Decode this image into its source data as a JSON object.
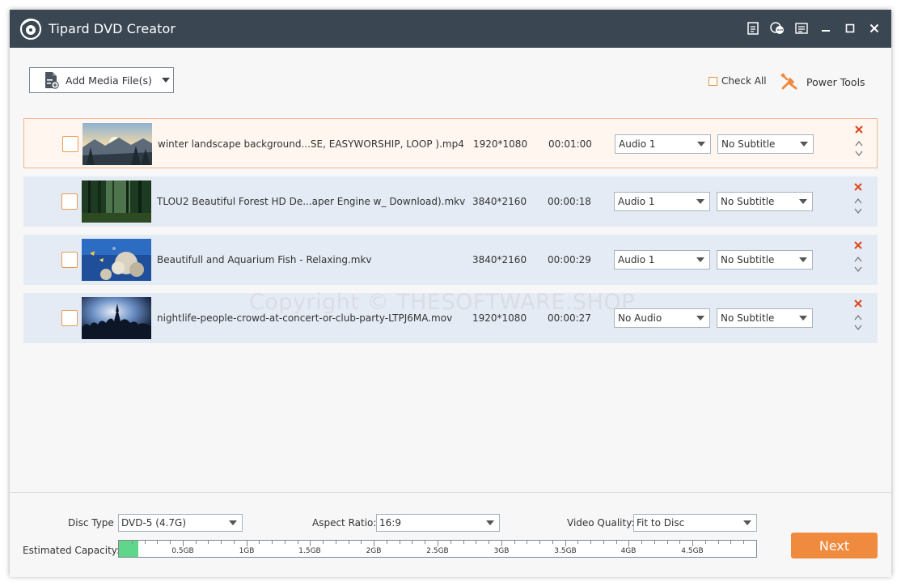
{
  "app": {
    "title": "Tipard DVD Creator"
  },
  "toolbar": {
    "add_media_label": "Add Media File(s)",
    "check_all_label": "Check All",
    "power_tools_label": "Power Tools"
  },
  "files": [
    {
      "name": "winter landscape background...SE, EASYWORSHIP, LOOP ).mp4",
      "resolution": "1920*1080",
      "duration": "00:01:00",
      "audio": "Audio 1",
      "subtitle": "No Subtitle",
      "selected": true
    },
    {
      "name": "TLOU2 Beautiful Forest HD De...aper Engine w_ Download).mkv",
      "resolution": "3840*2160",
      "duration": "00:00:18",
      "audio": "Audio 1",
      "subtitle": "No Subtitle",
      "selected": false
    },
    {
      "name": "Beautifull and Aquarium Fish - Relaxing.mkv",
      "resolution": "3840*2160",
      "duration": "00:00:29",
      "audio": "Audio 1",
      "subtitle": "No Subtitle",
      "selected": false
    },
    {
      "name": "nightlife-people-crowd-at-concert-or-club-party-LTPJ6MA.mov",
      "resolution": "1920*1080",
      "duration": "00:00:27",
      "audio": "No Audio",
      "subtitle": "No Subtitle",
      "selected": false
    }
  ],
  "watermark": "Copyright © THESOFTWARE.SHOP",
  "bottom": {
    "disc_type_label": "Disc Type",
    "disc_type_value": "DVD-5 (4.7G)",
    "aspect_ratio_label": "Aspect Ratio:",
    "aspect_ratio_value": "16:9",
    "video_quality_label": "Video Quality:",
    "video_quality_value": "Fit to Disc",
    "estimated_capacity_label": "Estimated Capacity:",
    "capacity_fill_gb": 0.15,
    "capacity_scale_max_gb": 5.0,
    "capacity_ticks": [
      "0.5GB",
      "1GB",
      "1.5GB",
      "2GB",
      "2.5GB",
      "3GB",
      "3.5GB",
      "4GB",
      "4.5GB"
    ],
    "next_label": "Next"
  },
  "colors": {
    "titlebar": "#3a4652",
    "accent": "#f08a3e",
    "row_bg": "#e5ebf4",
    "selected_row_bg": "#fff6f0",
    "capacity_fill": "#5fd68a",
    "delete_x": "#e0451f"
  }
}
